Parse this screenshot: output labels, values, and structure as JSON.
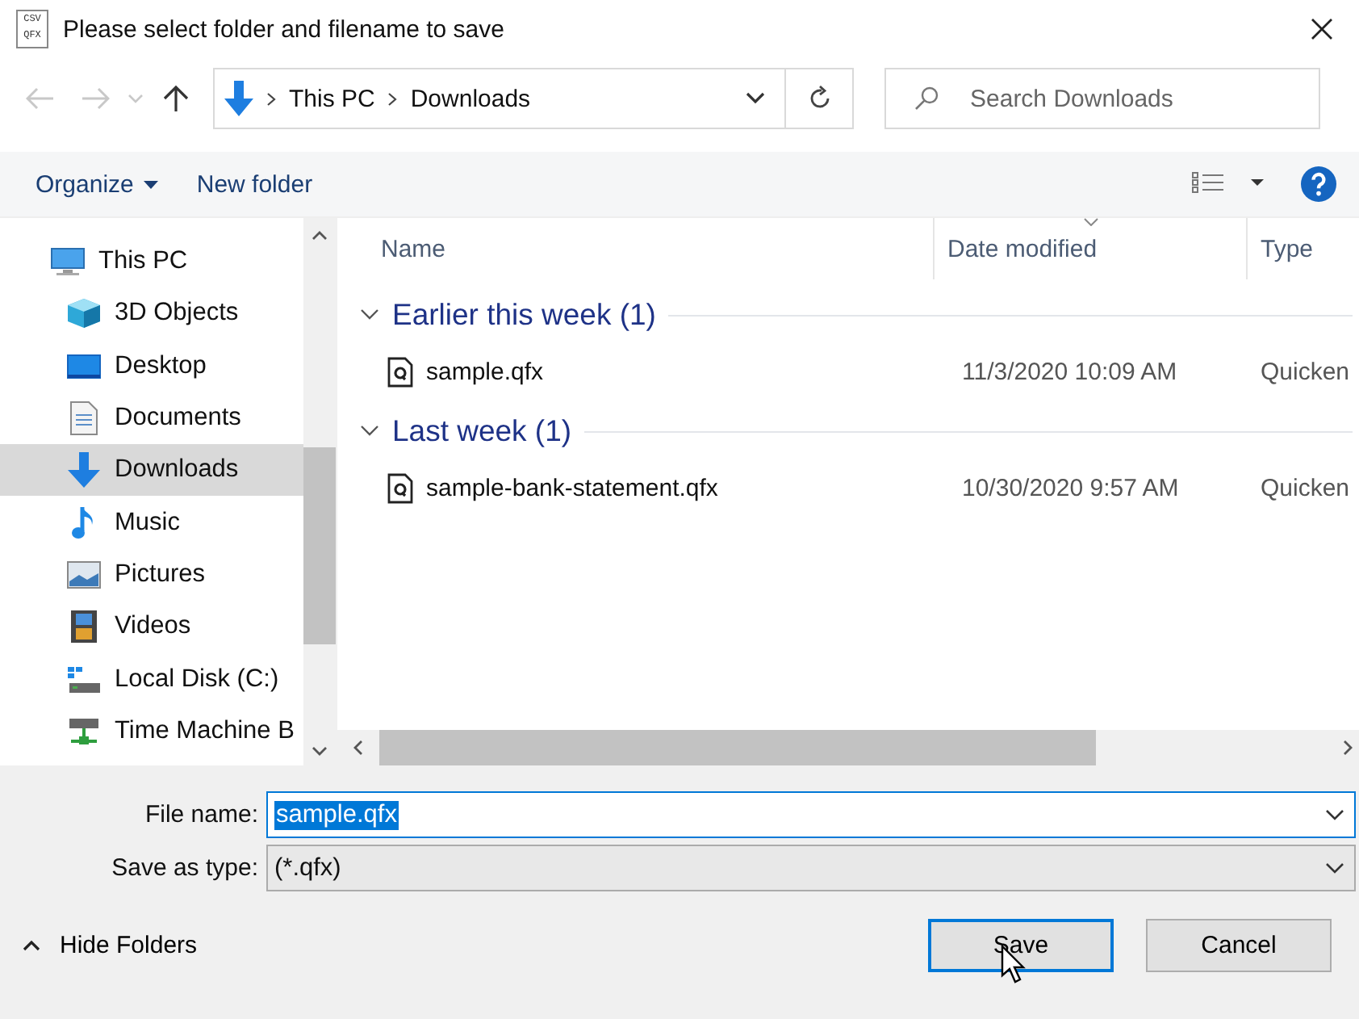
{
  "window": {
    "title": "Please select folder and filename to save",
    "app_icon_lines": [
      "CSV",
      "QFX"
    ]
  },
  "nav": {
    "back_disabled": true,
    "forward_disabled": true,
    "path": [
      "This PC",
      "Downloads"
    ],
    "search_placeholder": "Search Downloads"
  },
  "toolbar": {
    "organize": "Organize",
    "new_folder": "New folder"
  },
  "sidebar": {
    "items": [
      {
        "label": "This PC",
        "kind": "pc",
        "selected": false,
        "children": [
          {
            "label": "3D Objects",
            "kind": "cube",
            "selected": false
          },
          {
            "label": "Desktop",
            "kind": "desktop",
            "selected": false
          },
          {
            "label": "Documents",
            "kind": "documents",
            "selected": false
          },
          {
            "label": "Downloads",
            "kind": "downloads",
            "selected": true
          },
          {
            "label": "Music",
            "kind": "music",
            "selected": false
          },
          {
            "label": "Pictures",
            "kind": "pictures",
            "selected": false
          },
          {
            "label": "Videos",
            "kind": "videos",
            "selected": false
          },
          {
            "label": "Local Disk (C:)",
            "kind": "disk",
            "selected": false
          },
          {
            "label": "Time Machine B",
            "kind": "network",
            "selected": false
          }
        ]
      }
    ]
  },
  "table": {
    "columns": [
      {
        "label": "Name",
        "sorted": false
      },
      {
        "label": "Date modified",
        "sorted": true
      },
      {
        "label": "Type",
        "sorted": false
      }
    ],
    "groups": [
      {
        "label": "Earlier this week (1)",
        "expanded": true,
        "rows": [
          {
            "name": "sample.qfx",
            "date": "11/3/2020 10:09 AM",
            "type": "Quicken"
          }
        ]
      },
      {
        "label": "Last week (1)",
        "expanded": true,
        "rows": [
          {
            "name": "sample-bank-statement.qfx",
            "date": "10/30/2020 9:57 AM",
            "type": "Quicken"
          }
        ]
      }
    ]
  },
  "form": {
    "file_name_label": "File name:",
    "file_name": "sample.qfx",
    "type_label": "Save as type:",
    "type_value": "(*.qfx)"
  },
  "footer": {
    "hide_folders": "Hide Folders",
    "buttons": [
      {
        "label": "Save",
        "kind": "default"
      },
      {
        "label": "Cancel",
        "kind": "normal"
      }
    ]
  }
}
